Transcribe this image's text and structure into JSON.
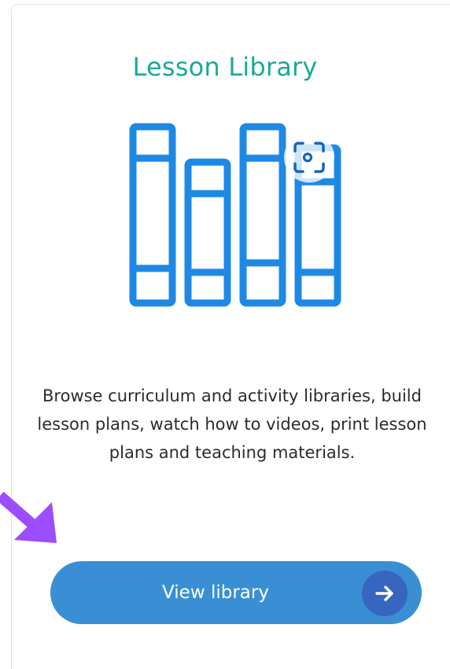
{
  "card": {
    "title": "Lesson Library",
    "description": "Browse curriculum and activity libraries, build lesson plans, watch how to videos, print lesson plans and teaching materials.",
    "button_label": "View library"
  },
  "icons": {
    "illustration": "books-icon",
    "badge": "visual-search-icon",
    "button_arrow": "arrow-right-icon",
    "pointer": "pointer-arrow-icon"
  },
  "colors": {
    "title": "#1ba99a",
    "books": "#1e88e5",
    "button": "#3a8fd4",
    "button_arrow_circle": "#3666c0",
    "pointer": "#9b4dff"
  }
}
